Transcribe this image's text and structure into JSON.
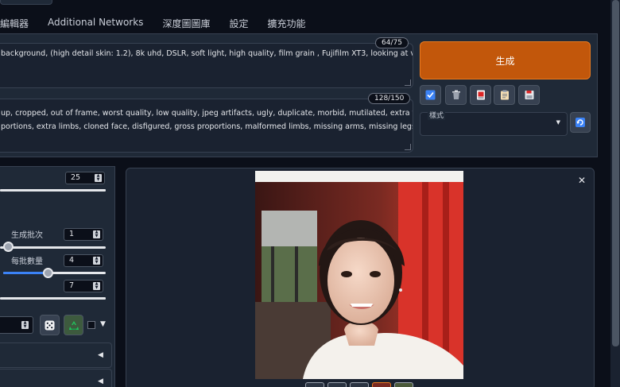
{
  "tabs": [
    "編輯器",
    "Additional Networks",
    "深度圖圖庫",
    "設定",
    "擴充功能"
  ],
  "prompt": {
    "text": "background, (high detail skin: 1.2), 8k uhd, DSLR, soft light, high quality, film grain , Fujifilm XT3, looking at viewer,",
    "counter": "64/75"
  },
  "negative_prompt": {
    "line1": "up, cropped, out of frame, worst quality, low quality, jpeg artifacts, ugly, duplicate, morbid, mutilated, extra fingers, mutated",
    "line2": "portions, extra limbs, cloned face, disfigured, gross proportions, malformed limbs, missing arms, missing legs, extra arms, extra",
    "counter": "128/150"
  },
  "generate": {
    "label": "生成"
  },
  "styles": {
    "label": "樣式",
    "value": ""
  },
  "params": {
    "steps": {
      "value": "25",
      "fraction": 1.0
    },
    "batch_count": {
      "label": "生成批次",
      "value": "1",
      "fraction": 0.0
    },
    "batch_size": {
      "label": "每批數量",
      "value": "4",
      "fraction": 0.43
    },
    "cfg_scale": {
      "value": "7",
      "fraction": 1.0
    }
  },
  "colors": {
    "accent": "#c2570b",
    "background": "#0b0f19",
    "panel": "#1f2937",
    "slider_fill": "#3b82f6"
  },
  "icons": [
    "checkbox-icon",
    "trash-icon",
    "card-icon",
    "clipboard-icon",
    "save-icon",
    "refresh-icon",
    "dice-icon",
    "recycle-icon",
    "close-icon"
  ]
}
